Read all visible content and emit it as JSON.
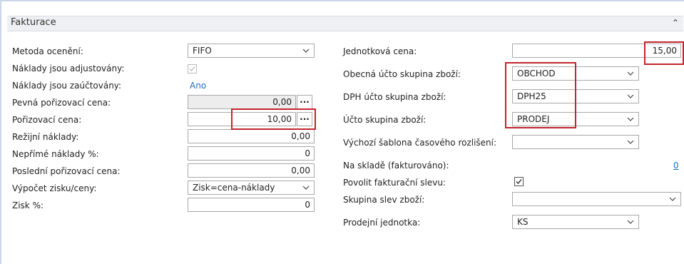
{
  "section": {
    "title": "Fakturace"
  },
  "left": {
    "metoda": {
      "label": "Metoda ocenění:",
      "value": "FIFO"
    },
    "adjustovany": {
      "label": "Náklady jsou adjustovány:",
      "checked": true
    },
    "zauctovany": {
      "label": "Náklady jsou zaúčtovány:",
      "value": "Ano"
    },
    "pevna": {
      "label": "Pevná pořizovací cena:",
      "value": "0,00",
      "button": "..."
    },
    "porizovaci": {
      "label": "Pořizovací cena:",
      "value": "10,00",
      "button": "..."
    },
    "rezijni": {
      "label": "Režijní náklady:",
      "value": "0,00"
    },
    "neprime": {
      "label": "Nepřímé náklady %:",
      "value": "0"
    },
    "posledni": {
      "label": "Poslední pořizovací cena:",
      "value": "0,00"
    },
    "vypocet": {
      "label": "Výpočet zisku/ceny:",
      "value": "Zisk=cena-náklady"
    },
    "zisk": {
      "label": "Zisk %:",
      "value": "0"
    }
  },
  "right": {
    "jednotkova": {
      "label": "Jednotková cena:",
      "value": "15,00"
    },
    "obecna": {
      "label": "Obecná účto skupina zboží:",
      "value": "OBCHOD"
    },
    "dph": {
      "label": "DPH účto skupina zboží:",
      "value": "DPH25"
    },
    "ucto": {
      "label": "Účto skupina zboží:",
      "value": "PRODEJ"
    },
    "sablona": {
      "label": "Výchozí šablona časového rozlišení:",
      "value": ""
    },
    "sklad": {
      "label": "Na skladě (fakturováno):",
      "value": "0"
    },
    "sleva": {
      "label": "Povolit fakturační slevu:",
      "checked": true
    },
    "skupina_slev": {
      "label": "Skupina slev zboží:",
      "value": ""
    },
    "jednotka": {
      "label": "Prodejní jednotka:",
      "value": "KS"
    }
  },
  "colors": {
    "highlight": "#c0262c",
    "link": "#1a6fc4"
  }
}
